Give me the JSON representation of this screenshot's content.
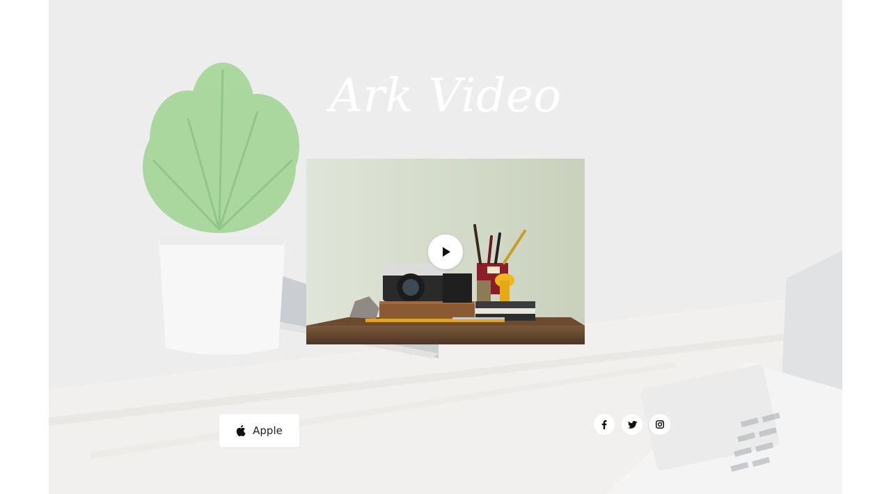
{
  "hero": {
    "title": "Ark Video"
  },
  "video": {
    "play_icon": "play-icon"
  },
  "store_button": {
    "label": "Apple",
    "icon": "apple-icon"
  },
  "social": [
    {
      "name": "facebook",
      "icon": "facebook-icon"
    },
    {
      "name": "twitter",
      "icon": "twitter-icon"
    },
    {
      "name": "instagram",
      "icon": "instagram-icon"
    }
  ],
  "colors": {
    "background": "#e6e6e8",
    "title": "#ffffff",
    "button": "#ffffff",
    "icon": "#111111"
  }
}
